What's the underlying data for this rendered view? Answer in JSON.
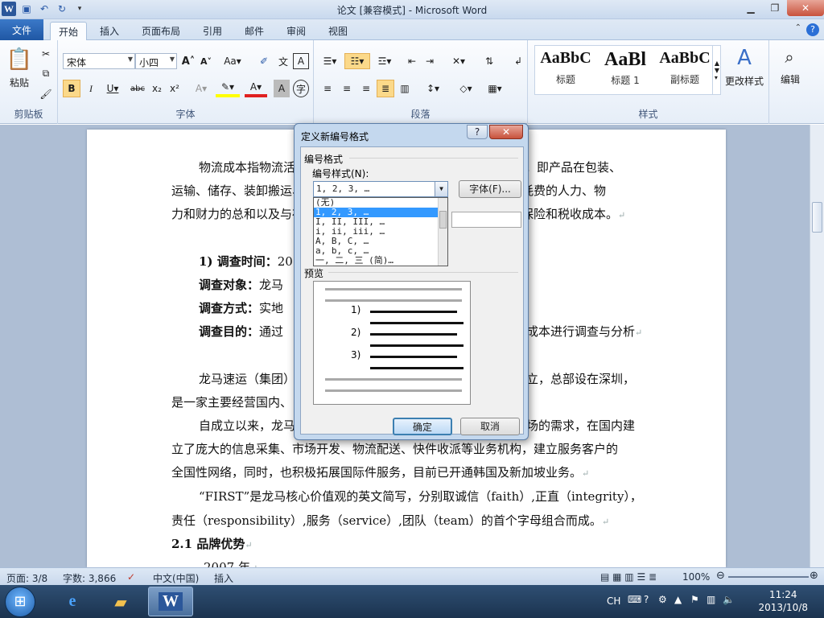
{
  "window": {
    "title": "论文 [兼容模式] - Microsoft Word"
  },
  "tabs": [
    "文件",
    "开始",
    "插入",
    "页面布局",
    "引用",
    "邮件",
    "审阅",
    "视图"
  ],
  "ribbon": {
    "clipboard": {
      "label": "剪贴板",
      "paste": "粘贴"
    },
    "font": {
      "label": "字体",
      "font_name": "宋体",
      "font_size": "小四"
    },
    "paragraph": {
      "label": "段落"
    },
    "styles": {
      "label": "样式",
      "items": [
        {
          "preview": "AaBbC",
          "name": "标题"
        },
        {
          "preview": "AaBl",
          "name": "标题 1"
        },
        {
          "preview": "AaBbC",
          "name": "副标题"
        }
      ],
      "change_styles": "更改样式"
    },
    "editing": {
      "label": "编辑"
    }
  },
  "document": {
    "lines": [
      "物流成本指物流活动中所消耗的物化劳动和活劳动的货币表现。即产品在包装、",
      "运输、储存、装卸搬运、流通加工、物流信息、物流管理过程中所耗费的人力、物",
      "力和财力的总和以及与存货有关的流动资金占用成本、存货风险、保险和税收成本。"
    ],
    "survey": {
      "time_label": "1)  调查时间：",
      "time_value": "20",
      "object_label": "调查对象：",
      "object_value": "龙马",
      "method_label": "调查方式：",
      "method_value": "实地",
      "purpose_label": "调查目的：",
      "purpose_value": "通过",
      "purpose_tail": "成本进行调查与分析"
    },
    "para2": [
      "龙马速运（集团）",
      "立，总部设在深圳，",
      "是一家主要经营国内、"
    ],
    "para3": [
      "自成立以来，龙马",
      "场的需求，在国内建",
      "立了庞大的信息采集、市场开发、物流配送、快件收派等业务机构，建立服务客户的",
      "全国性网络，同时，也积极拓展国际件服务，目前已开通韩国及新加坡业务。"
    ],
    "para4": [
      "“FIRST”是龙马核心价值观的英文简写，分别取诚信（faith）,正直（integrity），",
      "责任（responsibility）,服务（service）,团队（team）的首个字母组合而成。"
    ],
    "heading": "2.1  品牌优势",
    "last_line": "2007 年"
  },
  "status": {
    "page": "页面: 3/8",
    "words": "字数: 3,866",
    "lang": "中文(中国)",
    "mode": "插入",
    "zoom": "100%"
  },
  "taskbar": {
    "ime": "CH",
    "time": "11:24",
    "date": "2013/10/8"
  },
  "dialog": {
    "title": "定义新编号格式",
    "help": "?",
    "section_label": "编号格式",
    "style_label": "编号样式(N):",
    "selected_style": "1, 2, 3, …",
    "font_button": "字体(F)...",
    "options": [
      "(无)",
      "1, 2, 3, …",
      "I, II, III, …",
      "i, ii, iii, …",
      "A, B, C, …",
      "a, b, c, …",
      "一, 二, 三 (简)…"
    ],
    "selected_index": 1,
    "preview_label": "预览",
    "preview_numbers": [
      "1)",
      "2)",
      "3)"
    ],
    "ok": "确定",
    "cancel": "取消"
  },
  "colors": {
    "accent": "#2b579a",
    "highlight": "#fbd98a",
    "selection": "#3399ff"
  }
}
